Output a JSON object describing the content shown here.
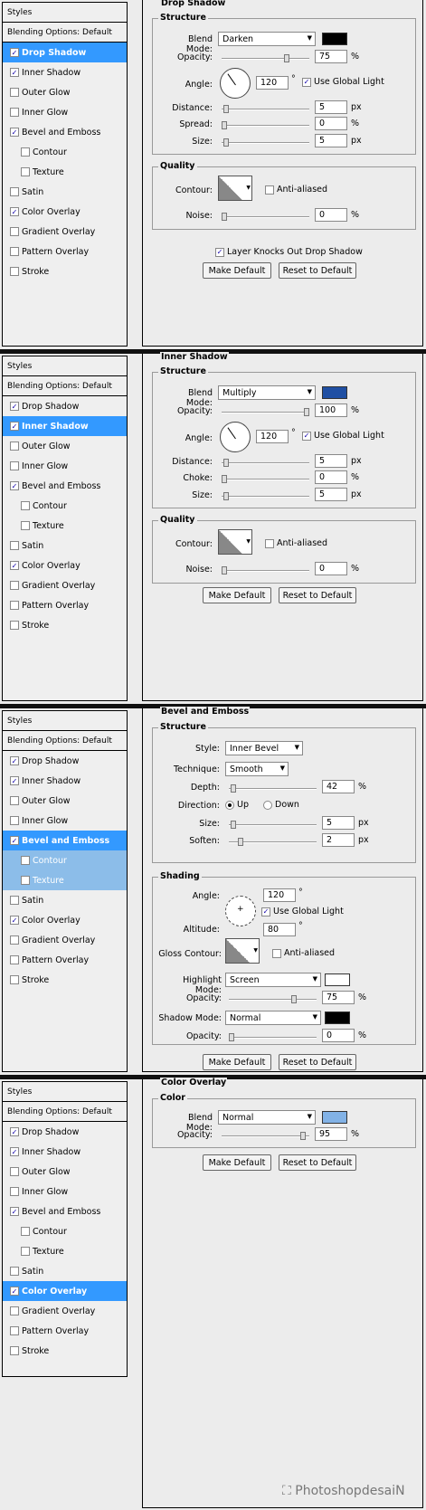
{
  "common": {
    "styles_header": "Styles",
    "blending": "Blending Options: Default",
    "make_default": "Make Default",
    "reset_default": "Reset to Default",
    "px": "px",
    "pct": "%",
    "deg": "°"
  },
  "style_items": [
    "Drop Shadow",
    "Inner Shadow",
    "Outer Glow",
    "Inner Glow",
    "Bevel and Emboss",
    "Contour",
    "Texture",
    "Satin",
    "Color Overlay",
    "Gradient Overlay",
    "Pattern Overlay",
    "Stroke"
  ],
  "checked": [
    true,
    true,
    false,
    false,
    true,
    false,
    false,
    false,
    true,
    false,
    false,
    false
  ],
  "ds": {
    "title": "Drop Shadow",
    "structure": "Structure",
    "blend_label": "Blend Mode:",
    "blend": "Darken",
    "color": "#000000",
    "opacity_label": "Opacity:",
    "opacity": "75",
    "angle_label": "Angle:",
    "angle": "120",
    "global": "Use Global Light",
    "distance_label": "Distance:",
    "distance": "5",
    "spread_label": "Spread:",
    "spread": "0",
    "size_label": "Size:",
    "size": "5",
    "quality": "Quality",
    "contour_label": "Contour:",
    "anti": "Anti-aliased",
    "noise_label": "Noise:",
    "noise": "0",
    "knocks": "Layer Knocks Out Drop Shadow"
  },
  "is": {
    "title": "Inner Shadow",
    "structure": "Structure",
    "blend_label": "Blend Mode:",
    "blend": "Multiply",
    "color": "#1f4fa3",
    "opacity_label": "Opacity:",
    "opacity": "100",
    "angle_label": "Angle:",
    "angle": "120",
    "global": "Use Global Light",
    "distance_label": "Distance:",
    "distance": "5",
    "choke_label": "Choke:",
    "choke": "0",
    "size_label": "Size:",
    "size": "5",
    "quality": "Quality",
    "contour_label": "Contour:",
    "anti": "Anti-aliased",
    "noise_label": "Noise:",
    "noise": "0"
  },
  "be": {
    "title": "Bevel and Emboss",
    "structure": "Structure",
    "style_label": "Style:",
    "style": "Inner Bevel",
    "technique_label": "Technique:",
    "technique": "Smooth",
    "depth_label": "Depth:",
    "depth": "42",
    "direction_label": "Direction:",
    "up": "Up",
    "down": "Down",
    "size_label": "Size:",
    "size": "5",
    "soften_label": "Soften:",
    "soften": "2",
    "shading": "Shading",
    "angle_label": "Angle:",
    "angle": "120",
    "global": "Use Global Light",
    "altitude_label": "Altitude:",
    "altitude": "80",
    "gloss_label": "Gloss Contour:",
    "anti": "Anti-aliased",
    "hl_label": "Highlight Mode:",
    "hl": "Screen",
    "hl_color": "#ffffff",
    "hl_op_label": "Opacity:",
    "hl_op": "75",
    "sh_label": "Shadow Mode:",
    "sh": "Normal",
    "sh_color": "#000000",
    "sh_op_label": "Opacity:",
    "sh_op": "0"
  },
  "co": {
    "title": "Color Overlay",
    "color_grp": "Color",
    "blend_label": "Blend Mode:",
    "blend": "Normal",
    "color": "#82b2e6",
    "opacity_label": "Opacity:",
    "opacity": "95"
  },
  "watermark": "PhotoshopdesaiN"
}
